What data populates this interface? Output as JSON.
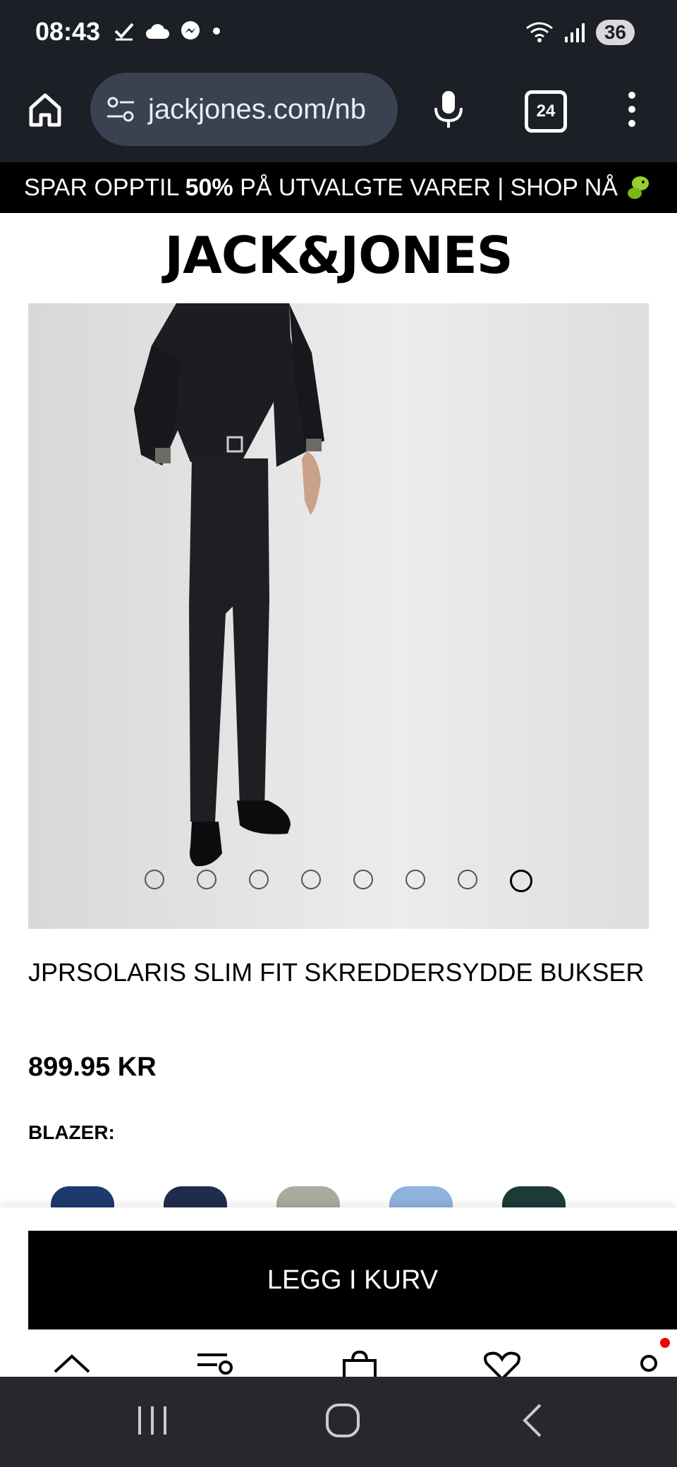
{
  "status_bar": {
    "time": "08:43",
    "battery": "36",
    "left_icons": [
      "check-icon",
      "cloud-icon",
      "messenger-icon",
      "dot-icon"
    ],
    "right_icons": [
      "wifi-icon",
      "signal-icon"
    ]
  },
  "browser": {
    "url": "jackjones.com/nb",
    "tab_count": "24",
    "icons": [
      "home-icon",
      "site-settings-icon",
      "mic-icon",
      "tabs-icon",
      "menu-icon"
    ]
  },
  "promo": {
    "text_before": "SPAR OPPTIL ",
    "highlight": "50%",
    "text_after": " PÅ UTVALGTE VARER | SHOP NÅ"
  },
  "brand": {
    "logo": "JACK&JONES"
  },
  "product": {
    "title": "JPRSOLARIS SLIM FIT SKREDDERSYDDE BUKSER",
    "price": "899.95 KR",
    "image_count": 8,
    "active_image_index": 7,
    "blazer_label": "BLAZER:",
    "blazer_colors": [
      "#1d3a6e",
      "#1f2d4d",
      "#a9ab9c",
      "#8fb2de",
      "#1c3a38"
    ]
  },
  "cart": {
    "add_label": "LEGG I KURV"
  },
  "bottom_nav": {
    "items": [
      "home-icon",
      "menu-icon",
      "bag-icon",
      "heart-icon",
      "account-icon"
    ]
  },
  "colors": {
    "dark_bar": "#1c1f26",
    "url_pill": "#3a4150",
    "notification": "#ee0000"
  }
}
